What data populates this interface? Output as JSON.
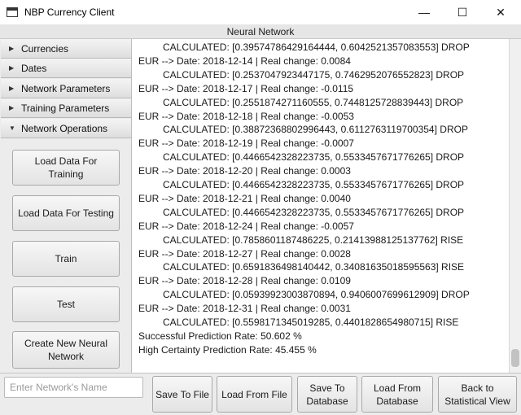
{
  "window": {
    "title": "NBP Currency Client",
    "minimize_glyph": "—",
    "maximize_glyph": "☐",
    "close_glyph": "✕"
  },
  "stage_title": "Neural Network",
  "sidebar": {
    "sections": [
      {
        "label": "Currencies",
        "expanded": false
      },
      {
        "label": "Dates",
        "expanded": false
      },
      {
        "label": "Network Parameters",
        "expanded": false
      },
      {
        "label": "Training Parameters",
        "expanded": false
      },
      {
        "label": "Network Operations",
        "expanded": true
      }
    ],
    "buttons": [
      "Load Data For Training",
      "Load Data For Testing",
      "Train",
      "Test",
      "Create New Neural Network"
    ]
  },
  "log": {
    "lines": [
      {
        "text": "CALCULATED: [0.39574786429164444, 0.6042521357083553] DROP",
        "indent": true
      },
      {
        "text": "EUR --> Date: 2018-12-14 | Real change: 0.0084",
        "indent": false
      },
      {
        "text": "CALCULATED: [0.2537047923447175, 0.7462952076552823] DROP",
        "indent": true
      },
      {
        "text": "EUR --> Date: 2018-12-17 | Real change: -0.0115",
        "indent": false
      },
      {
        "text": "CALCULATED: [0.2551874271160555, 0.7448125728839443] DROP",
        "indent": true
      },
      {
        "text": "EUR --> Date: 2018-12-18 | Real change: -0.0053",
        "indent": false
      },
      {
        "text": "CALCULATED: [0.38872368802996443, 0.6112763119700354] DROP",
        "indent": true
      },
      {
        "text": "EUR --> Date: 2018-12-19 | Real change: -0.0007",
        "indent": false
      },
      {
        "text": "CALCULATED: [0.4466542328223735, 0.5533457671776265] DROP",
        "indent": true
      },
      {
        "text": "EUR --> Date: 2018-12-20 | Real change: 0.0003",
        "indent": false
      },
      {
        "text": "CALCULATED: [0.4466542328223735, 0.5533457671776265] DROP",
        "indent": true
      },
      {
        "text": "EUR --> Date: 2018-12-21 | Real change: 0.0040",
        "indent": false
      },
      {
        "text": "CALCULATED: [0.4466542328223735, 0.5533457671776265] DROP",
        "indent": true
      },
      {
        "text": "EUR --> Date: 2018-12-24 | Real change: -0.0057",
        "indent": false
      },
      {
        "text": "CALCULATED: [0.7858601187486225, 0.21413988125137762] RISE",
        "indent": true
      },
      {
        "text": "EUR --> Date: 2018-12-27 | Real change: 0.0028",
        "indent": false
      },
      {
        "text": "CALCULATED: [0.6591836498140442, 0.34081635018595563] RISE",
        "indent": true
      },
      {
        "text": "EUR --> Date: 2018-12-28 | Real change: 0.0109",
        "indent": false
      },
      {
        "text": "CALCULATED: [0.05939923003870894, 0.9406007699612909] DROP",
        "indent": true
      },
      {
        "text": "EUR --> Date: 2018-12-31 | Real change: 0.0031",
        "indent": false
      },
      {
        "text": "CALCULATED: [0.5598171345019285, 0.4401828654980715] RISE",
        "indent": true
      },
      {
        "text": "Successful Prediction Rate: 50.602 %",
        "indent": false
      },
      {
        "text": "High Certainty Prediction Rate: 45.455 %",
        "indent": false
      }
    ]
  },
  "bottom": {
    "name_placeholder": "Enter Network's Name",
    "name_value": "",
    "buttons": [
      "Save To File",
      "Load From File",
      "Save To Database",
      "Load From Database",
      "Back to Statistical View"
    ]
  },
  "colors": {
    "button_border": "#a9a9a9",
    "sidebar_bg": "#ececec",
    "text": "#1a1a1a"
  }
}
